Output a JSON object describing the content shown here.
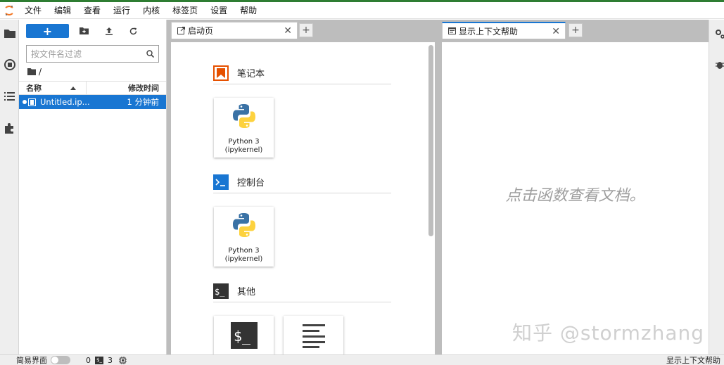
{
  "menu": [
    "文件",
    "编辑",
    "查看",
    "运行",
    "内核",
    "标签页",
    "设置",
    "帮助"
  ],
  "filebrowser": {
    "new_label": "+",
    "filter_placeholder": "按文件名过滤",
    "path": "/",
    "col_name": "名称",
    "col_time": "修改时间",
    "files": [
      {
        "name": "Untitled.ip...",
        "time": "1 分钟前"
      }
    ]
  },
  "tabs": {
    "launcher_title": "启动页",
    "help_title": "显示上下文帮助"
  },
  "launcher": {
    "notebook_title": "笔记本",
    "console_title": "控制台",
    "other_title": "其他",
    "notebook_card_line1": "Python 3",
    "notebook_card_line2": "(ipykernel)",
    "console_card_line1": "Python 3",
    "console_card_line2": "(ipykernel)"
  },
  "help": {
    "message": "点击函数查看文档。",
    "watermark": "知乎 @stormzhang"
  },
  "status": {
    "simple_mode": "简易界面",
    "kernels": "0",
    "terminals": "3",
    "right_text": "显示上下文帮助"
  },
  "colors": {
    "accent": "#1976d2",
    "notebook_orange": "#e65100",
    "console_blue": "#1976d2"
  }
}
